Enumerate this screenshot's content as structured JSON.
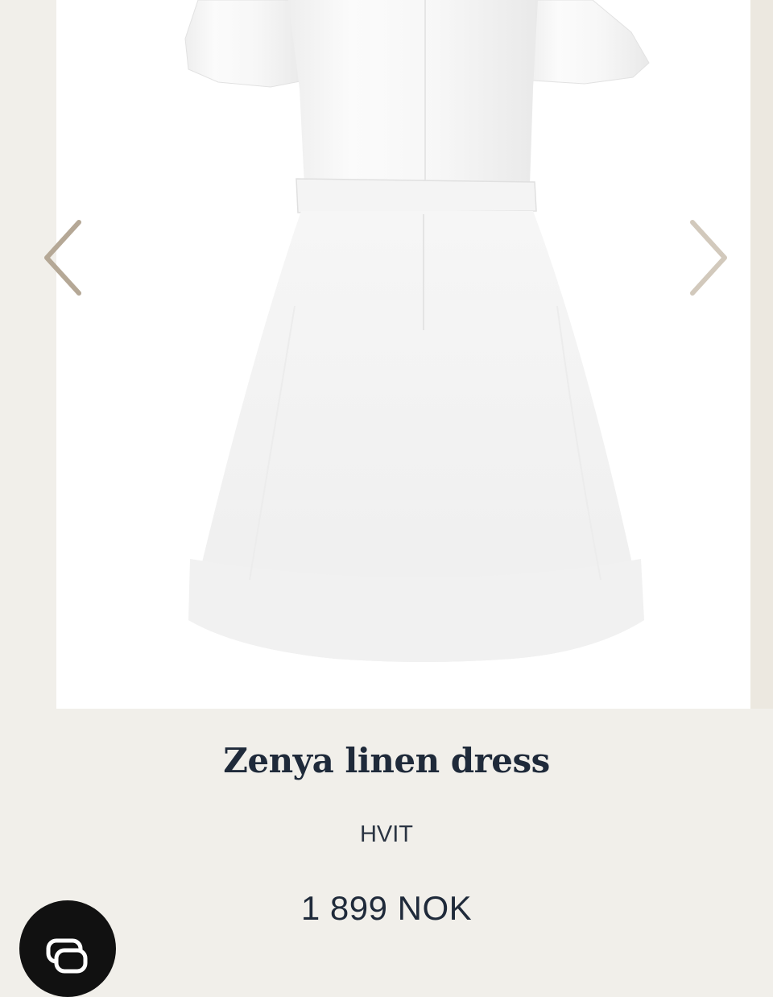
{
  "product": {
    "name": "Zenya linen dress",
    "color": "HVIT",
    "price": "1 899 NOK"
  },
  "gallery": {
    "image_alt": "white linen dress back view",
    "prev_icon": "chevron-left-icon",
    "next_icon": "chevron-right-icon"
  },
  "chat": {
    "icon": "chat-icon"
  },
  "colors": {
    "background": "#f1efea",
    "text": "#1f2a3a",
    "arrow": "#b5a896",
    "chat_button": "#111111"
  }
}
